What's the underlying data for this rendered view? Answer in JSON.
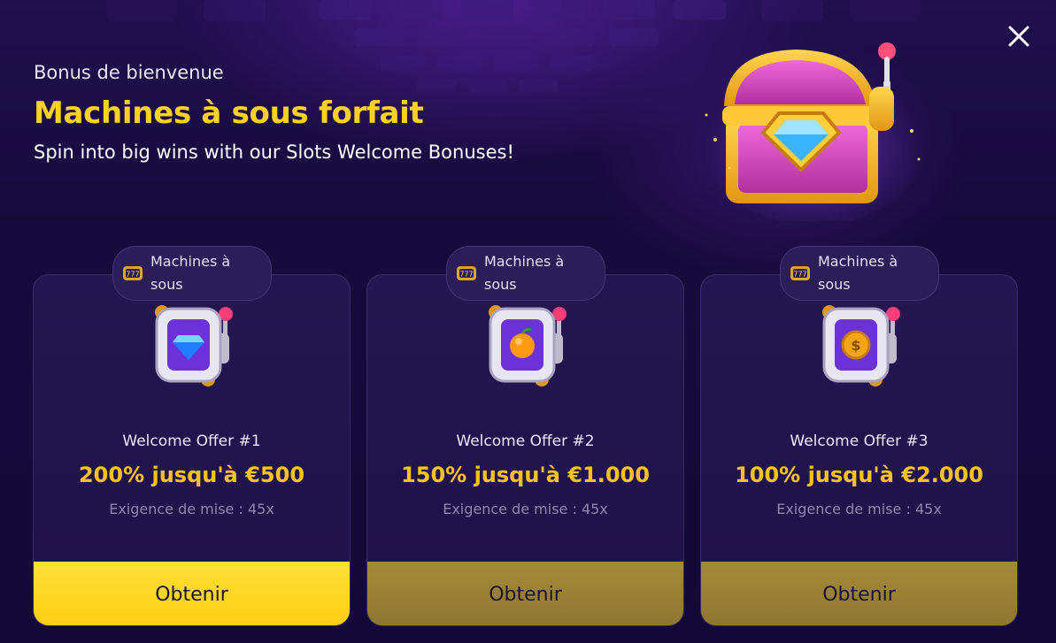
{
  "modal": {
    "eyebrow": "Bonus de bienvenue",
    "title": "Machines à sous forfait",
    "subtitle": "Spin into big wins with our Slots Welcome Bonuses!",
    "close_icon": "close-icon",
    "hero_icon": "treasure-chest-icon"
  },
  "offers": [
    {
      "tag_icon": "slot-777-icon",
      "tag_label": "Machines à sous",
      "machine_icon": "slot-machine-diamond-icon",
      "name": "Welcome Offer #1",
      "amount": "200% jusqu'à €500",
      "requirement": "Exigence de mise : 45x",
      "cta": "Obtenir",
      "cta_state": "active"
    },
    {
      "tag_icon": "slot-777-icon",
      "tag_label": "Machines à sous",
      "machine_icon": "slot-machine-orange-icon",
      "name": "Welcome Offer #2",
      "amount": "150% jusqu'à €1.000",
      "requirement": "Exigence de mise : 45x",
      "cta": "Obtenir",
      "cta_state": "muted"
    },
    {
      "tag_icon": "slot-777-icon",
      "tag_label": "Machines à sous",
      "machine_icon": "slot-machine-coin-icon",
      "name": "Welcome Offer #3",
      "amount": "100% jusqu'à €2.000",
      "requirement": "Exigence de mise : 45x",
      "cta": "Obtenir",
      "cta_state": "muted"
    }
  ],
  "colors": {
    "accent_yellow": "#ffd21f",
    "background": "#140a36",
    "card": "#241650",
    "cta_primary": "#ffd52a",
    "cta_muted": "#9c8336"
  }
}
